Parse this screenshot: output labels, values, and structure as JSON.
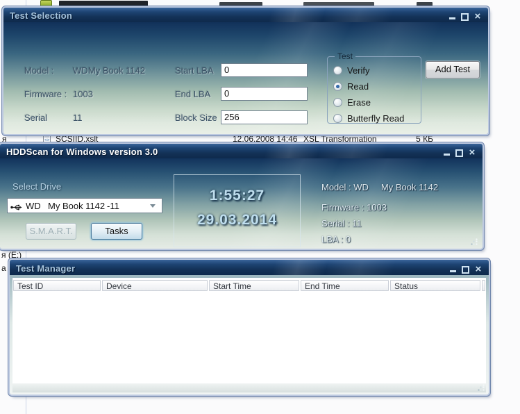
{
  "background": {
    "file_row": {
      "name": "SCSIID.xslt",
      "date": "12.06.2008 14:46",
      "type": "XSL Transformation",
      "size": "5 КБ"
    },
    "fragments": {
      "mid": "я",
      "drive": "я (Е:)",
      "low": "a"
    }
  },
  "test_selection": {
    "title": "Test Selection",
    "info_rows": [
      {
        "label": "Model :",
        "v1": "WD",
        "v2": "My Book 1142"
      },
      {
        "label": "Firmware :",
        "v1": "1003",
        "v2": ""
      },
      {
        "label": "Serial",
        "v1": "11",
        "v2": ""
      }
    ],
    "lba_fields": [
      {
        "label": "Start LBA",
        "value": "0"
      },
      {
        "label": "End LBA",
        "value": "0"
      },
      {
        "label": "Block Size",
        "value": "256"
      }
    ],
    "test_group": {
      "legend": "Test",
      "selected": "Read",
      "options": [
        {
          "label": "Verify"
        },
        {
          "label": "Read"
        },
        {
          "label": "Erase"
        },
        {
          "label": "Butterfly Read"
        }
      ]
    },
    "add_test_button": "Add Test"
  },
  "main_window": {
    "title": "HDDScan for Windows version 3.0",
    "select_drive_label": "Select Drive",
    "drive": {
      "vendor": "WD",
      "model": "My Book 1142",
      "suffix": "-11"
    },
    "smart_button": "S.M.A.R.T.",
    "tasks_button": "Tasks",
    "clock": {
      "time": "1:55:27",
      "date": "29.03.2014"
    },
    "info_lines": [
      {
        "label": "Model : WD",
        "extra": "My Book 1142"
      },
      {
        "label": "Firmware : 1003",
        "extra": ""
      },
      {
        "label": "Serial : 11",
        "extra": ""
      },
      {
        "label": "LBA : 0",
        "extra": ""
      }
    ]
  },
  "test_manager": {
    "title": "Test Manager",
    "columns": [
      "Test ID",
      "Device",
      "Start Time",
      "End Time",
      "Status"
    ],
    "rows": []
  },
  "colors": {
    "titlebar_top": "#3a659a",
    "titlebar_bottom": "#0e2a4c",
    "clock_text": "#bfdeee",
    "radio_selected": "#1f4f8f",
    "window_border": "#bdc9e0"
  }
}
